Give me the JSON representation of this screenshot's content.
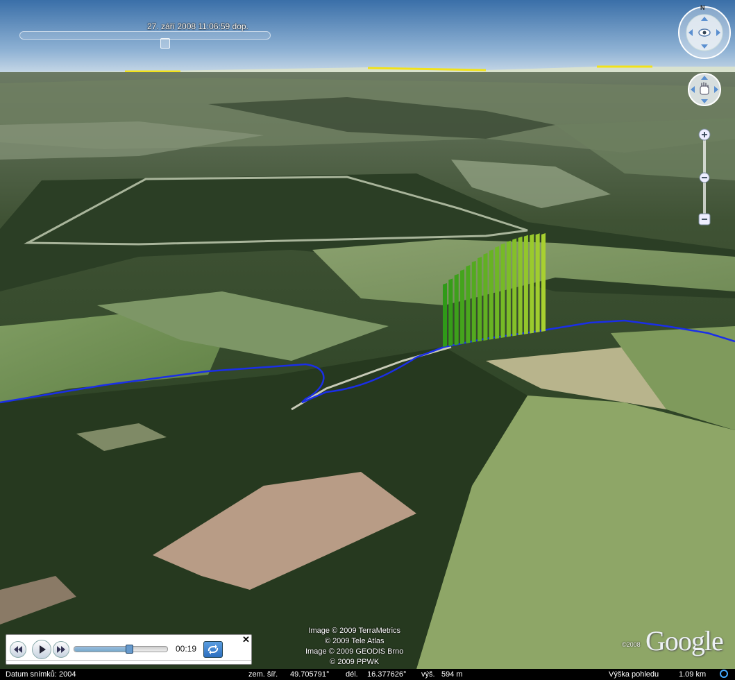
{
  "time_slider": {
    "datetime": "27. září 2008  11:06:59 dop.",
    "position": 0.5
  },
  "navigation": {
    "north_label": "N",
    "look_icon": "eye-icon",
    "move_icon": "hand-icon",
    "zoom_in_icon": "plus-icon",
    "zoom_out_icon": "minus-icon",
    "zoom_level": 0.5
  },
  "tour_player": {
    "time": "00:19",
    "progress": 0.59,
    "close_label": "✕",
    "buttons": [
      "rewind-icon",
      "play-icon",
      "fast-forward-icon",
      "repeat-icon"
    ]
  },
  "credits": [
    "Image © 2009 TerraMetrics",
    "© 2009 Tele Atlas",
    "Image © 2009 GEODIS Brno",
    "© 2009 PPWK"
  ],
  "branding": {
    "copyright_year": "©2008",
    "logo": "Google"
  },
  "status_bar": {
    "imagery_date": "Datum snímků: 2004",
    "lat_label": "zem. šíř.",
    "lat_value": "49.705791°",
    "lon_label": "dél.",
    "lon_value": "16.377626°",
    "elev_label": "výš.",
    "elev_value": "594 m",
    "eye_alt_label": "Výška pohledu",
    "eye_alt_value": "1.09 km"
  },
  "colors": {
    "sky_top": "#3a6fa8",
    "sky_horizon": "#c4d6e6",
    "track": "#1a2ee8",
    "curtain_dark": "#2f9a18",
    "curtain_light": "#a8d030"
  }
}
